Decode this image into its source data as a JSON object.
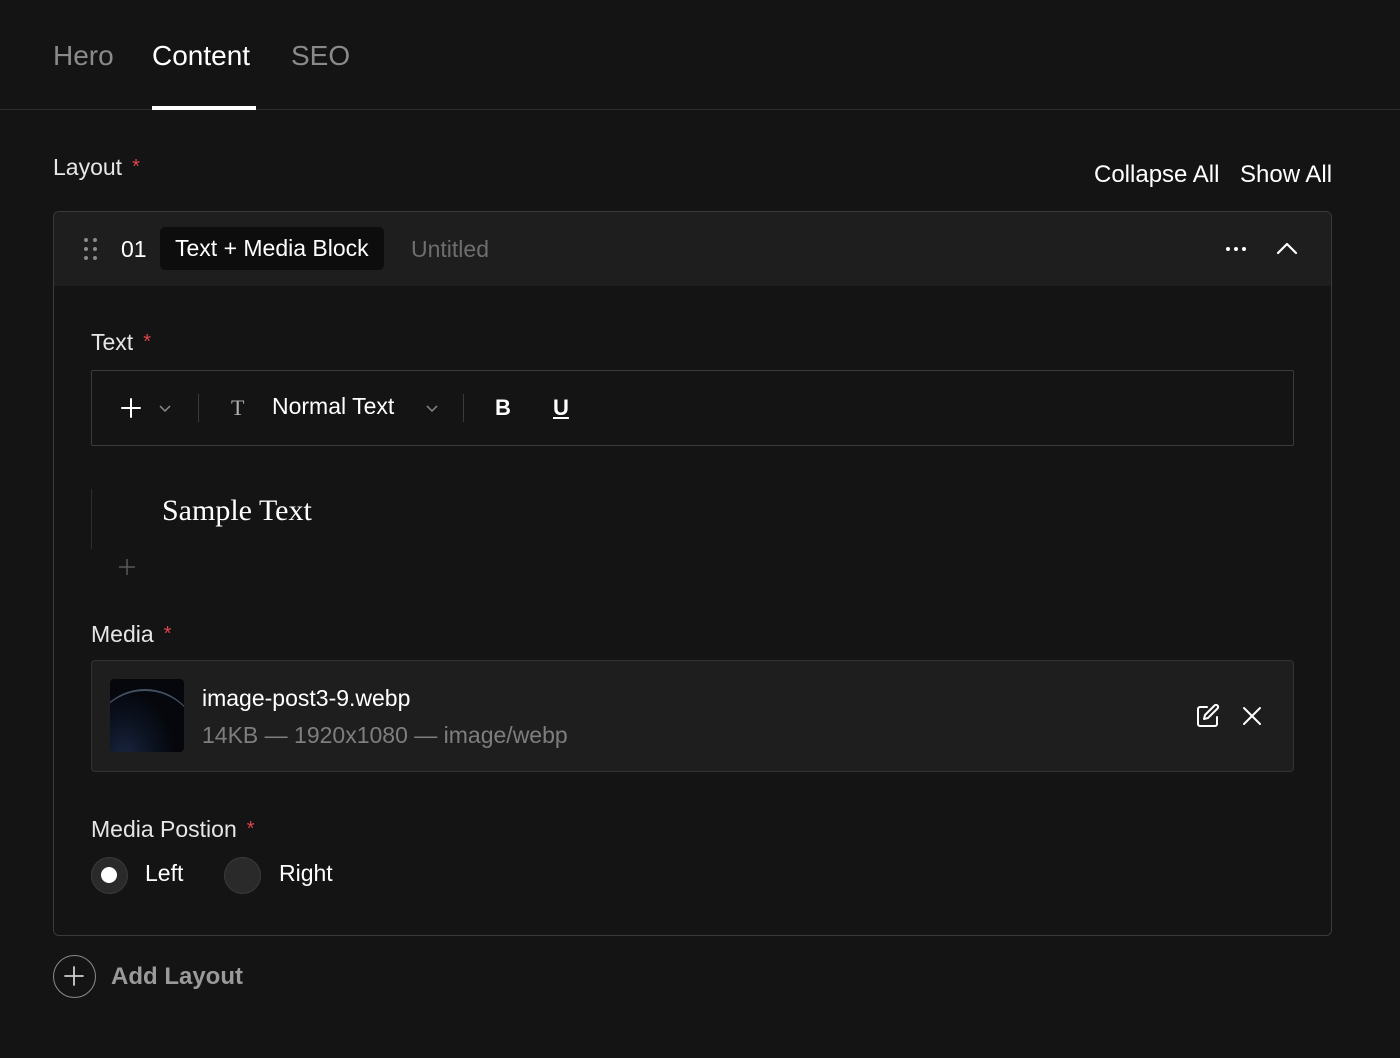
{
  "tabs": [
    {
      "label": "Hero"
    },
    {
      "label": "Content"
    },
    {
      "label": "SEO"
    }
  ],
  "active_tab": "Content",
  "layout": {
    "label": "Layout",
    "required_mark": "*",
    "collapse_all": "Collapse All",
    "show_all": "Show All",
    "add_layout": "Add Layout"
  },
  "block": {
    "number": "01",
    "type": "Text + Media Block",
    "title": "Untitled"
  },
  "text_field": {
    "label": "Text",
    "required_mark": "*",
    "toolbar": {
      "text_style_icon": "T",
      "text_style": "Normal Text",
      "bold": "B",
      "underline": "U"
    },
    "content": "Sample Text"
  },
  "media_field": {
    "label": "Media",
    "required_mark": "*",
    "file_name": "image-post3-9.webp",
    "file_meta": "14KB — 1920x1080 — image/webp"
  },
  "media_position": {
    "label": "Media Postion",
    "required_mark": "*",
    "options": [
      "Left",
      "Right"
    ],
    "selected": "Left"
  },
  "colors": {
    "background": "#141414",
    "panel": "#1e1e1e",
    "border": "#3a3a3a",
    "required": "#e0454a",
    "muted_text": "#8a8a8a"
  }
}
